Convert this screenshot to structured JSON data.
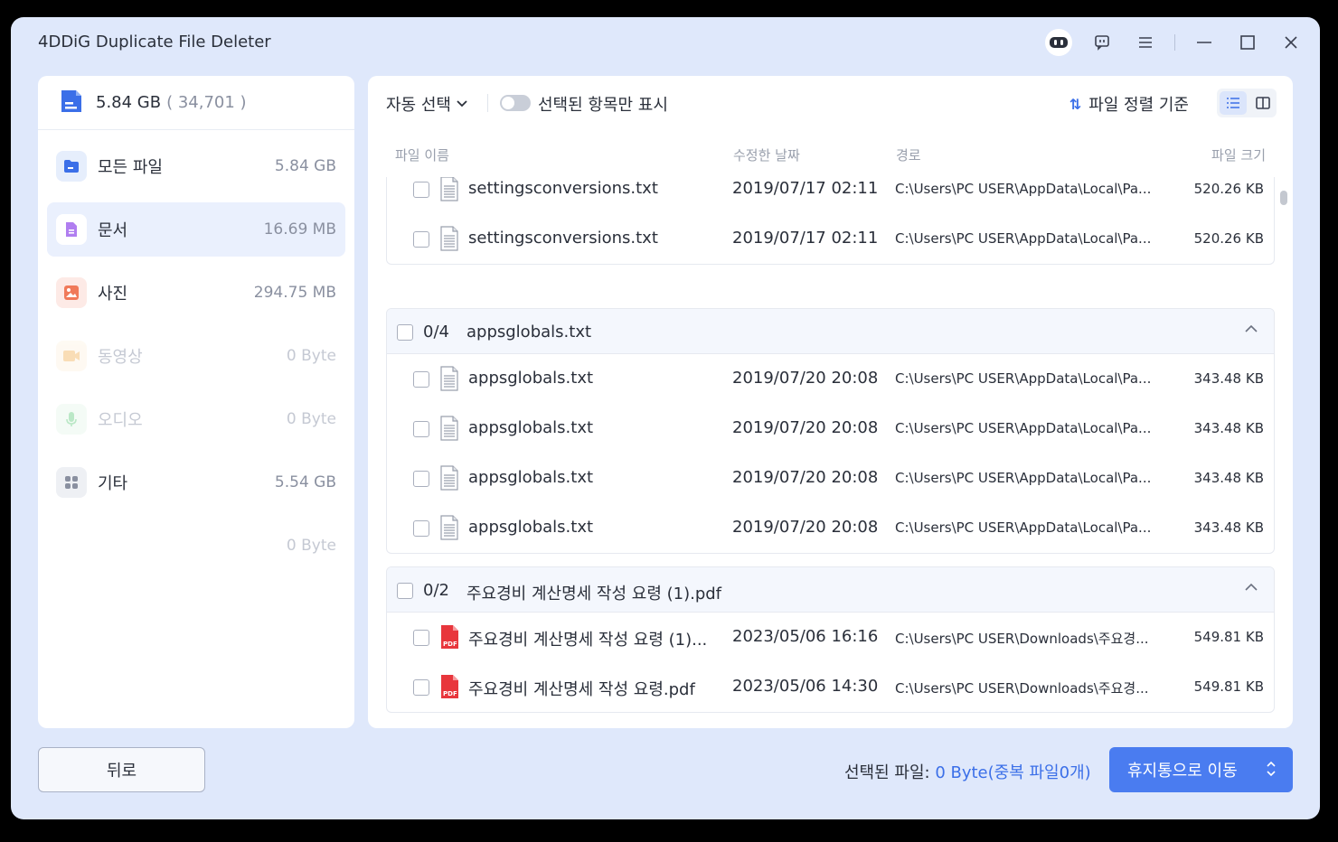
{
  "app": {
    "title": "4DDiG Duplicate File Deleter"
  },
  "colors": {
    "accent": "#4a7cf0",
    "bg": "#dfe8fb"
  },
  "sidebar": {
    "total": "5.84 GB",
    "count": "( 34,701 )",
    "items": [
      {
        "label": "모든 파일",
        "size": "5.84 GB",
        "icon": "folder-icon"
      },
      {
        "label": "문서",
        "size": "16.69 MB",
        "icon": "document-icon"
      },
      {
        "label": "사진",
        "size": "294.75 MB",
        "icon": "photo-icon"
      },
      {
        "label": "동영상",
        "size": "0 Byte",
        "icon": "video-icon"
      },
      {
        "label": "오디오",
        "size": "0 Byte",
        "icon": "microphone-icon"
      },
      {
        "label": "기타",
        "size": "5.54 GB",
        "icon": "grid-icon"
      },
      {
        "label": "",
        "size": "0 Byte",
        "icon": ""
      }
    ]
  },
  "toolbar": {
    "auto_select": "자동 선택",
    "show_selected_only": "선택된 항목만 표시",
    "sort_label": "파일 정렬 기준"
  },
  "columns": {
    "name": "파일 이름",
    "date": "수정한 날짜",
    "path": "경로",
    "size": "파일 크기"
  },
  "groups": [
    {
      "header": null,
      "rows": [
        {
          "name": "settingsconversions.txt",
          "date": "2019/07/17 02:11",
          "path": "C:\\Users\\PC USER\\AppData\\Local\\Pa...",
          "size": "520.26 KB",
          "type": "txt"
        },
        {
          "name": "settingsconversions.txt",
          "date": "2019/07/17 02:11",
          "path": "C:\\Users\\PC USER\\AppData\\Local\\Pa...",
          "size": "520.26 KB",
          "type": "txt"
        }
      ]
    },
    {
      "header": {
        "count": "0/4",
        "name": "appsglobals.txt"
      },
      "rows": [
        {
          "name": "appsglobals.txt",
          "date": "2019/07/20 20:08",
          "path": "C:\\Users\\PC USER\\AppData\\Local\\Pa...",
          "size": "343.48 KB",
          "type": "txt"
        },
        {
          "name": "appsglobals.txt",
          "date": "2019/07/20 20:08",
          "path": "C:\\Users\\PC USER\\AppData\\Local\\Pa...",
          "size": "343.48 KB",
          "type": "txt"
        },
        {
          "name": "appsglobals.txt",
          "date": "2019/07/20 20:08",
          "path": "C:\\Users\\PC USER\\AppData\\Local\\Pa...",
          "size": "343.48 KB",
          "type": "txt"
        },
        {
          "name": "appsglobals.txt",
          "date": "2019/07/20 20:08",
          "path": "C:\\Users\\PC USER\\AppData\\Local\\Pa...",
          "size": "343.48 KB",
          "type": "txt"
        }
      ]
    },
    {
      "header": {
        "count": "0/2",
        "name": "주요경비 계산명세 작성 요령 (1).pdf"
      },
      "rows": [
        {
          "name": "주요경비 계산명세 작성 요령 (1)...",
          "date": "2023/05/06 16:16",
          "path": "C:\\Users\\PC USER\\Downloads\\주요경...",
          "size": "549.81 KB",
          "type": "pdf"
        },
        {
          "name": "주요경비 계산명세 작성 요령.pdf",
          "date": "2023/05/06 14:30",
          "path": "C:\\Users\\PC USER\\Downloads\\주요경...",
          "size": "549.81 KB",
          "type": "pdf"
        }
      ]
    }
  ],
  "footer": {
    "back": "뒤로",
    "selected_label": "선택된 파일:",
    "selected_value": "0 Byte(중복 파일0개)",
    "move": "휴지통으로 이동"
  }
}
